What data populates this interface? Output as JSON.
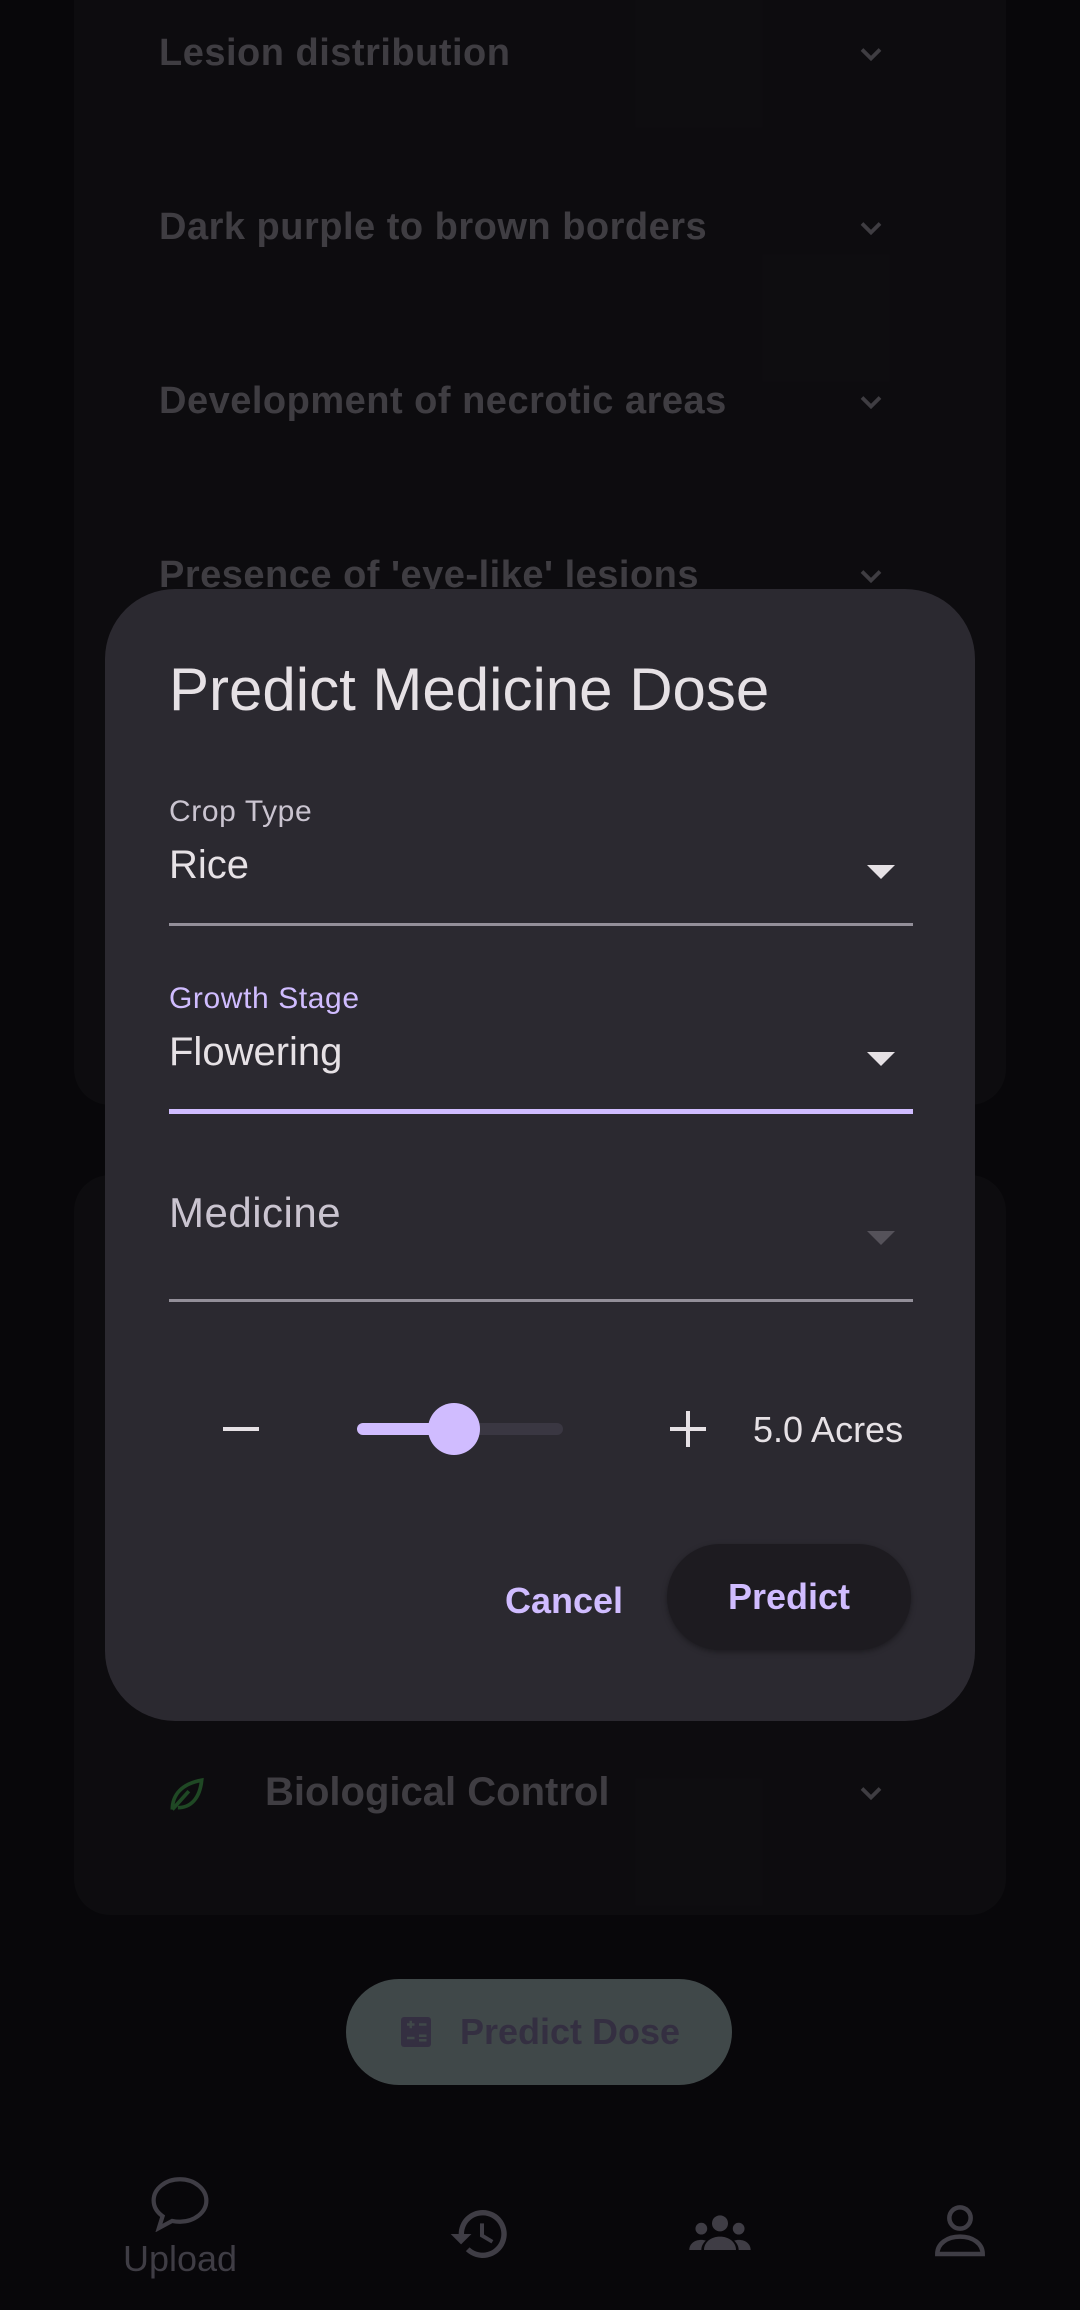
{
  "symptoms": [
    {
      "label": "Lesion distribution"
    },
    {
      "label": "Dark purple to brown borders"
    },
    {
      "label": "Development of necrotic areas"
    },
    {
      "label": "Presence of 'eye-like' lesions"
    }
  ],
  "treatment": {
    "label": "Biological Control",
    "icon": "leaf-icon",
    "icon_color": "#2e6b35"
  },
  "fab": {
    "label": "Predict Dose",
    "icon": "calculator-icon"
  },
  "nav": {
    "items": [
      {
        "label": "Upload",
        "icon": "chat-bubble-icon"
      },
      {
        "label": "",
        "icon": "history-icon"
      },
      {
        "label": "",
        "icon": "community-icon"
      },
      {
        "label": "",
        "icon": "profile-icon"
      }
    ]
  },
  "dialog": {
    "title": "Predict Medicine Dose",
    "crop_type": {
      "label": "Crop Type",
      "value": "Rice"
    },
    "growth_stage": {
      "label": "Growth Stage",
      "value": "Flowering"
    },
    "medicine": {
      "placeholder": "Medicine"
    },
    "area": {
      "value_text": "5.0 Acres",
      "slider_fraction": 0.47
    },
    "cancel_label": "Cancel",
    "predict_label": "Predict"
  },
  "colors": {
    "accent": "#d0bcff",
    "surface": "#2b2930",
    "background": "#0c0b0f"
  }
}
